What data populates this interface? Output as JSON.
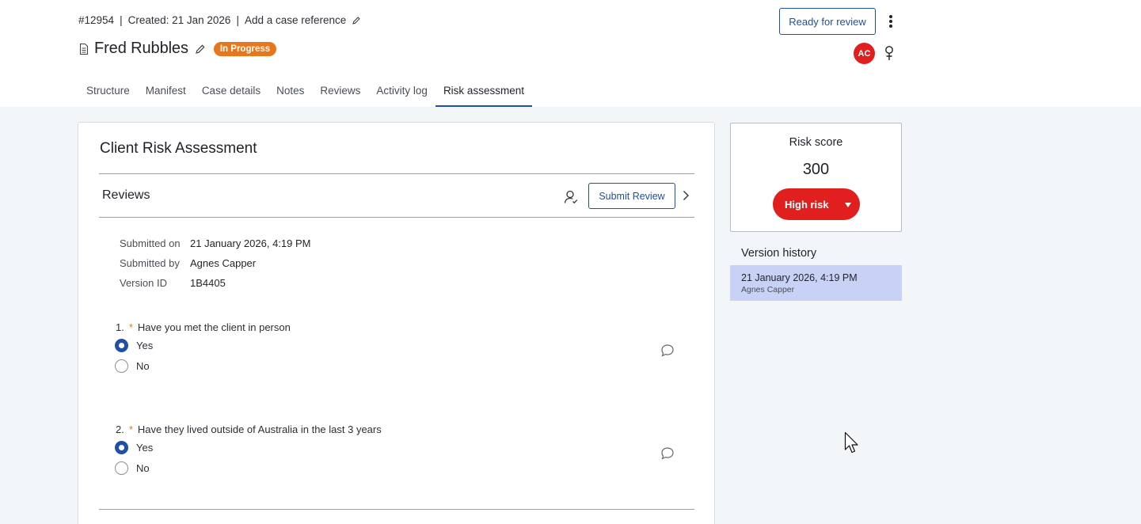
{
  "header": {
    "case_number": "#12954",
    "separator": "|",
    "created": "Created: 21 Jan 2026",
    "case_reference_link": "Add a case reference",
    "case_name": "Fred Rubbles",
    "status_badge": "In Progress",
    "status_color": "#e8771c",
    "ready_button": "Ready for review",
    "avatar_initials": "AC",
    "avatar_color": "#e11f1f"
  },
  "tabs": [
    {
      "label": "Structure"
    },
    {
      "label": "Manifest"
    },
    {
      "label": "Case details"
    },
    {
      "label": "Notes"
    },
    {
      "label": "Reviews"
    },
    {
      "label": "Activity log"
    },
    {
      "label": "Risk assessment",
      "active": true
    }
  ],
  "assessment": {
    "title": "Client Risk Assessment",
    "reviews_heading": "Reviews",
    "submit_button": "Submit Review",
    "submission": {
      "submitted_on_label": "Submitted on",
      "submitted_on_value": "21 January 2026, 4:19 PM",
      "submitted_by_label": "Submitted by",
      "submitted_by_value": "Agnes Capper",
      "version_label": "Version ID",
      "version_value": "1B4405"
    },
    "questions": [
      {
        "number": "1.",
        "required_marker": "*",
        "text": "Have you met the client in person",
        "options": [
          "Yes",
          "No"
        ],
        "selected": "Yes"
      },
      {
        "number": "2.",
        "required_marker": "*",
        "text": "Have they lived outside of Australia in the last 3 years",
        "options": [
          "Yes",
          "No"
        ],
        "selected": "Yes"
      }
    ]
  },
  "risk": {
    "label": "Risk score",
    "score": "300",
    "level_button": "High risk",
    "level_color": "#e11f1f"
  },
  "version_history": {
    "title": "Version history",
    "items": [
      {
        "date": "21 January 2026, 4:19 PM",
        "user": "Agnes Capper"
      }
    ]
  },
  "accent_color": "#1f4fa8"
}
